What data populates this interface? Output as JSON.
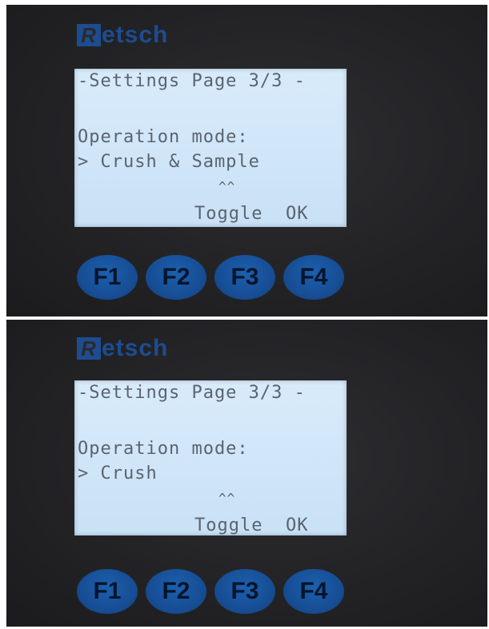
{
  "brand": {
    "logo_text": "Retsch"
  },
  "screens": [
    {
      "title_line": "-Settings Page 3/3 -",
      "mode_label": "Operation mode:",
      "mode_value": "> Crush & Sample",
      "carets": "^^",
      "softkeys": "Toggle  OK"
    },
    {
      "title_line": "-Settings Page 3/3 -",
      "mode_label": "Operation mode:",
      "mode_value": "> Crush",
      "carets": "^^",
      "softkeys": "Toggle  OK"
    }
  ],
  "function_keys": [
    "F1",
    "F2",
    "F3",
    "F4"
  ],
  "colors": {
    "panel_bg": "#232326",
    "lcd_bg": "#d3e8fa",
    "lcd_text": "#5a6470",
    "key_blue": "#174e95",
    "logo_blue": "#1d4c8f"
  }
}
